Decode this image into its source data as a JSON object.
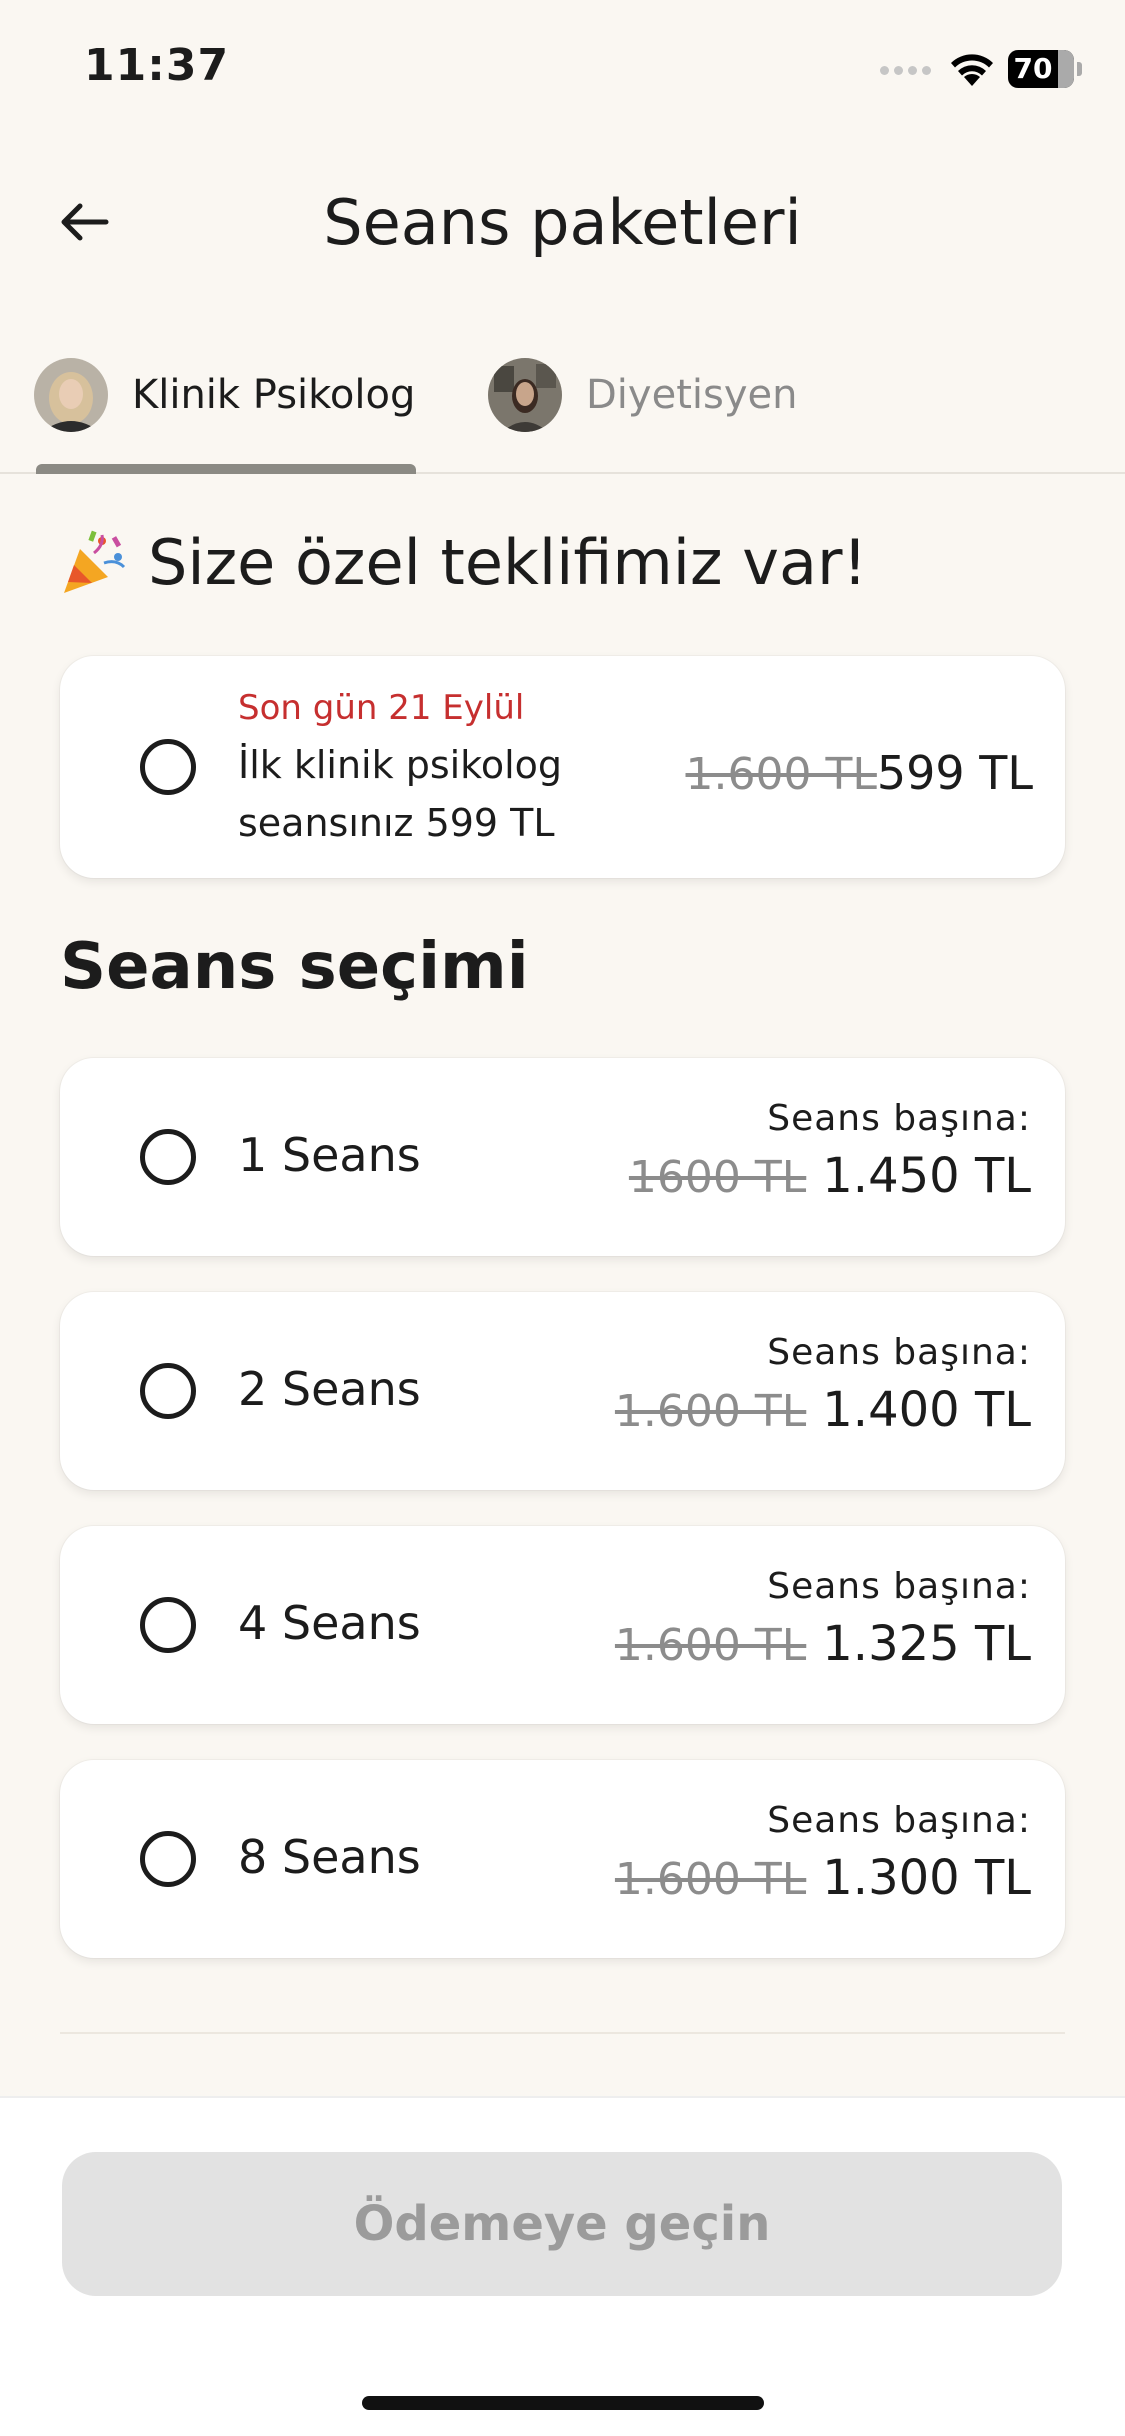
{
  "status_bar": {
    "time": "11:37",
    "battery": "70"
  },
  "header": {
    "title": "Seans paketleri"
  },
  "tabs": [
    {
      "label": "Klinik Psikolog",
      "active": true
    },
    {
      "label": "Diyetisyen",
      "active": false
    }
  ],
  "offer": {
    "heading": "Size özel teklifimiz var!",
    "deadline": "Son gün 21 Eylül",
    "description": "İlk klinik psikolog seansınız 599 TL",
    "old_price": "1.600 TL",
    "price": "599 TL"
  },
  "sessions": {
    "heading": "Seans seçimi",
    "per_session_label": "Seans başına:",
    "options": [
      {
        "label": "1 Seans",
        "old_price": "1600 TL",
        "price": "1.450 TL"
      },
      {
        "label": "2 Seans",
        "old_price": "1.600 TL",
        "price": "1.400 TL"
      },
      {
        "label": "4 Seans",
        "old_price": "1.600 TL",
        "price": "1.325 TL"
      },
      {
        "label": "8 Seans",
        "old_price": "1.600 TL",
        "price": "1.300 TL"
      }
    ]
  },
  "footer": {
    "button_label": "Ödemeye geçin",
    "button_enabled": false
  },
  "colors": {
    "background": "#faf7f2",
    "deadline": "#c62f2f",
    "disabled_button": "#e2e2e2"
  }
}
